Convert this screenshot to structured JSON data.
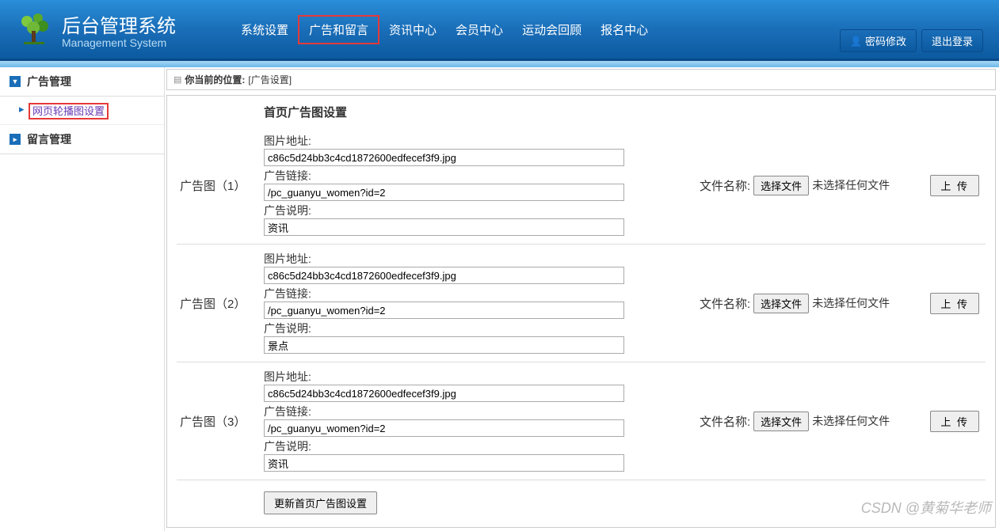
{
  "header": {
    "title": "后台管理系统",
    "subtitle": "Management System",
    "nav": [
      {
        "label": "系统设置",
        "active": false
      },
      {
        "label": "广告和留言",
        "active": true
      },
      {
        "label": "资讯中心",
        "active": false
      },
      {
        "label": "会员中心",
        "active": false
      },
      {
        "label": "运动会回顾",
        "active": false
      },
      {
        "label": "报名中心",
        "active": false
      }
    ],
    "user_buttons": {
      "password": "密码修改",
      "logout": "退出登录"
    }
  },
  "sidebar": {
    "groups": [
      {
        "label": "广告管理",
        "expanded": true,
        "items": [
          {
            "label": "网页轮播图设置",
            "highlighted": true
          }
        ]
      },
      {
        "label": "留言管理",
        "expanded": false,
        "items": []
      }
    ]
  },
  "breadcrumb": {
    "prefix": "你当前的位置:",
    "location": "[广告设置]"
  },
  "panel": {
    "title": "首页广告图设置",
    "field_labels": {
      "image_url": "图片地址:",
      "link": "广告链接:",
      "desc": "广告说明:",
      "file_name": "文件名称:",
      "choose_file": "选择文件",
      "no_file": "未选择任何文件",
      "upload": "上 传"
    },
    "ads": [
      {
        "label": "广告图（1）",
        "image_url": "c86c5d24bb3c4cd1872600edfecef3f9.jpg",
        "link": "/pc_guanyu_women?id=2",
        "desc": "资讯"
      },
      {
        "label": "广告图（2）",
        "image_url": "c86c5d24bb3c4cd1872600edfecef3f9.jpg",
        "link": "/pc_guanyu_women?id=2",
        "desc": "景点"
      },
      {
        "label": "广告图（3）",
        "image_url": "c86c5d24bb3c4cd1872600edfecef3f9.jpg",
        "link": "/pc_guanyu_women?id=2",
        "desc": "资讯"
      }
    ],
    "submit_label": "更新首页广告图设置"
  },
  "watermark": "CSDN @黄菊华老师"
}
